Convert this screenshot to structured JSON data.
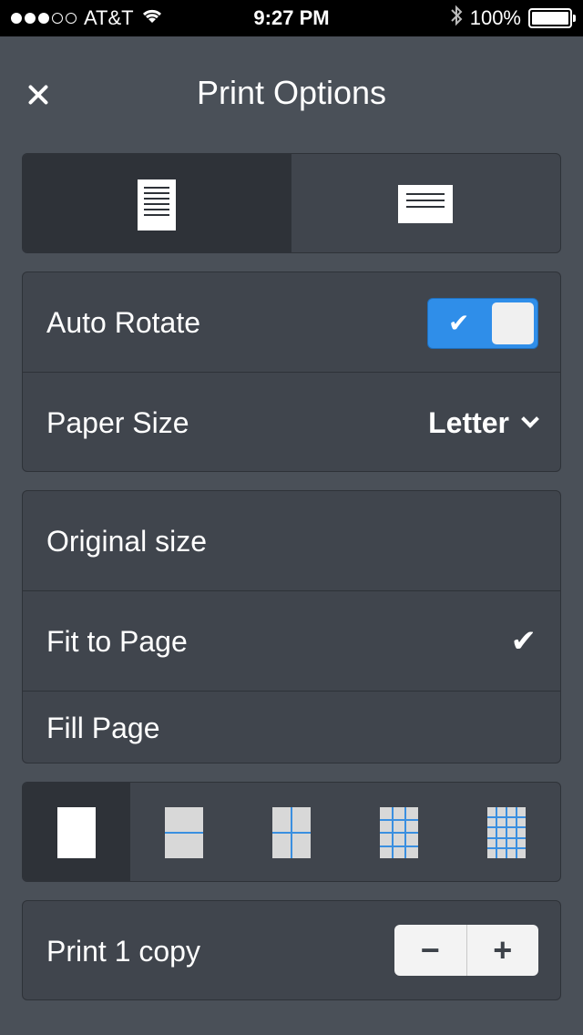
{
  "status_bar": {
    "carrier": "AT&T",
    "time": "9:27 PM",
    "battery": "100%",
    "signal_bars_filled": 3,
    "signal_bars_total": 5
  },
  "header": {
    "title": "Print Options"
  },
  "orientation": {
    "options": [
      "portrait",
      "landscape"
    ],
    "selected": "portrait"
  },
  "settings": {
    "auto_rotate_label": "Auto Rotate",
    "auto_rotate_on": true,
    "paper_size_label": "Paper Size",
    "paper_size_value": "Letter"
  },
  "scaling": {
    "options": [
      "Original size",
      "Fit to Page",
      "Fill Page"
    ],
    "selected": "Fit to Page"
  },
  "layouts": {
    "options": [
      "1-up",
      "2-up",
      "4-up",
      "9-up",
      "16-up"
    ],
    "selected": "1-up"
  },
  "copies": {
    "label": "Print 1 copy",
    "minus": "−",
    "plus": "+"
  },
  "colors": {
    "background": "#4a5058",
    "card": "#40454d",
    "selected_segment": "#2e3238",
    "accent": "#2f8ee9"
  }
}
